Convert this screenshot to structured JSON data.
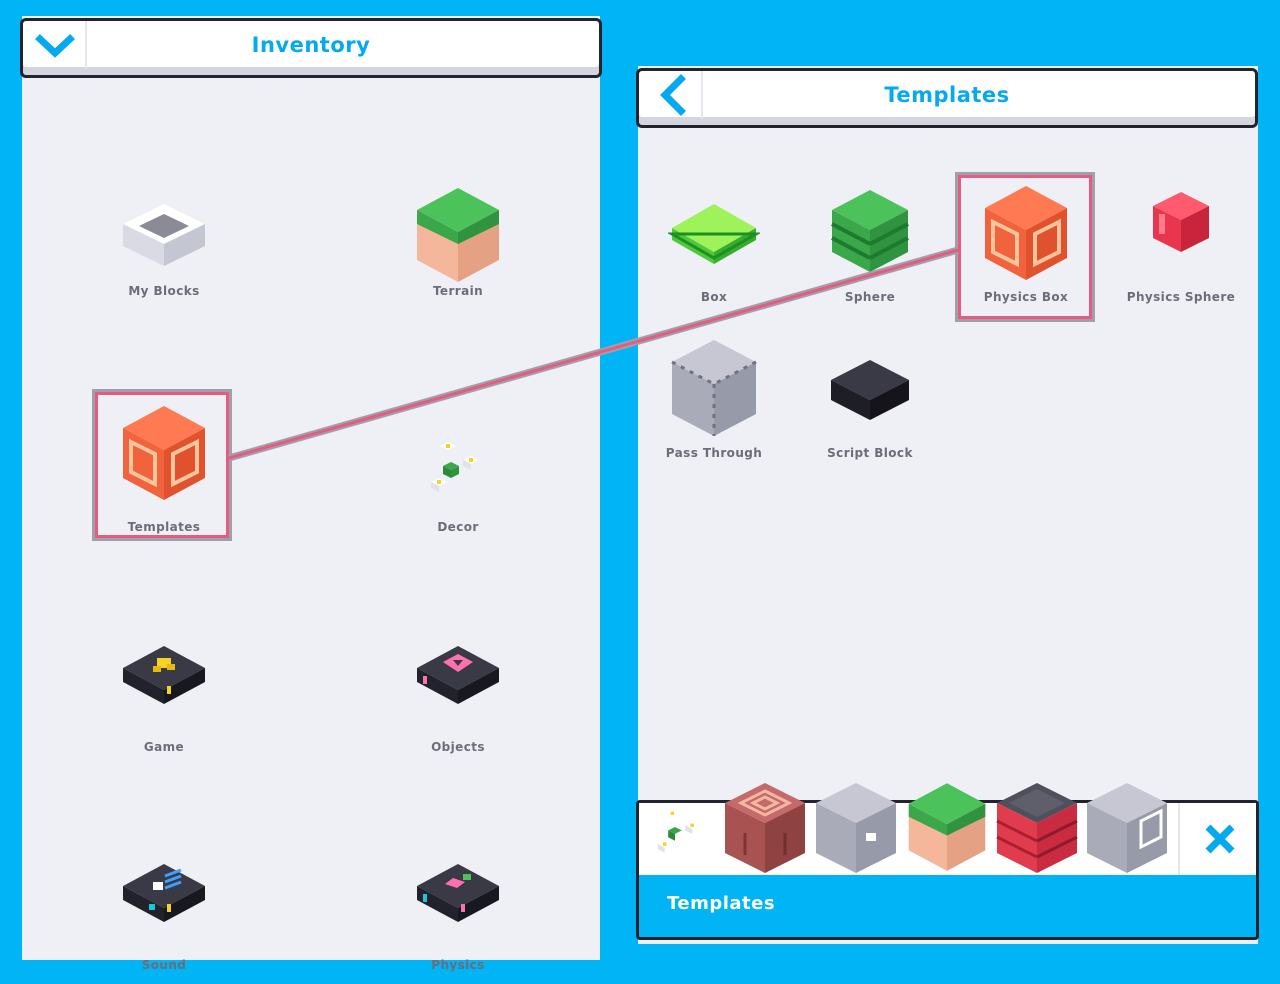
{
  "left_panel": {
    "title": "Inventory",
    "items": [
      {
        "label": "My Blocks",
        "icon": "empty-block-icon"
      },
      {
        "label": "Terrain",
        "icon": "grass-block-icon"
      },
      {
        "label": "Templates",
        "icon": "physics-box-icon"
      },
      {
        "label": "Decor",
        "icon": "flowers-icon"
      },
      {
        "label": "Game",
        "icon": "trophy-pad-icon"
      },
      {
        "label": "Objects",
        "icon": "heart-pad-icon"
      },
      {
        "label": "Sound",
        "icon": "sound-pad-icon"
      },
      {
        "label": "Physics",
        "icon": "physics-pad-icon"
      }
    ]
  },
  "right_panel": {
    "title": "Templates",
    "items": [
      {
        "label": "Box",
        "icon": "green-slab-icon"
      },
      {
        "label": "Sphere",
        "icon": "green-sphere-icon"
      },
      {
        "label": "Physics Box",
        "icon": "physics-box-icon"
      },
      {
        "label": "Physics Sphere",
        "icon": "red-sphere-icon"
      },
      {
        "label": "Pass Through",
        "icon": "pass-through-icon"
      },
      {
        "label": "Script Block",
        "icon": "script-block-icon"
      }
    ]
  },
  "hotbar": {
    "label": "Templates",
    "slots": [
      "flowers-icon",
      "target-block-icon",
      "gray-box-icon",
      "grass-block-icon",
      "brick-block-icon",
      "metal-block-icon"
    ]
  },
  "colors": {
    "background": "#00b4f5",
    "accent": "#05a9ef",
    "highlight": "#e85b80",
    "panel": "#eff0f5"
  }
}
